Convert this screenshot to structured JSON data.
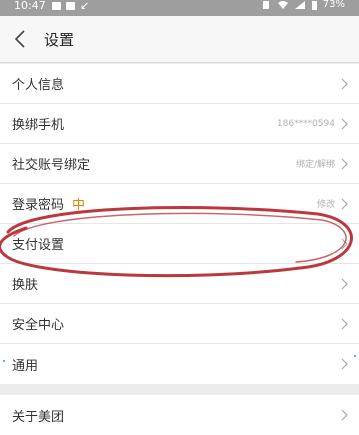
{
  "status_bar": {
    "time": "10:47",
    "battery": "73%"
  },
  "nav": {
    "title": "设置"
  },
  "settings": {
    "group1": [
      {
        "label": "个人信息",
        "value": ""
      },
      {
        "label": "换绑手机",
        "value": "186****0594"
      },
      {
        "label": "社交账号绑定",
        "value": "绑定/解绑"
      },
      {
        "label": "登录密码",
        "strength": "中",
        "value": "修改"
      },
      {
        "label": "支付设置",
        "value": ""
      },
      {
        "label": "换肤",
        "value": ""
      },
      {
        "label": "安全中心",
        "value": ""
      },
      {
        "label": "通用",
        "value": ""
      }
    ],
    "group2": [
      {
        "label": "关于美团",
        "value": ""
      }
    ]
  },
  "colors": {
    "status_bar": "#9e9e9e",
    "strength_medium": "#e8810f",
    "annotation_circle": "#b3232a"
  }
}
